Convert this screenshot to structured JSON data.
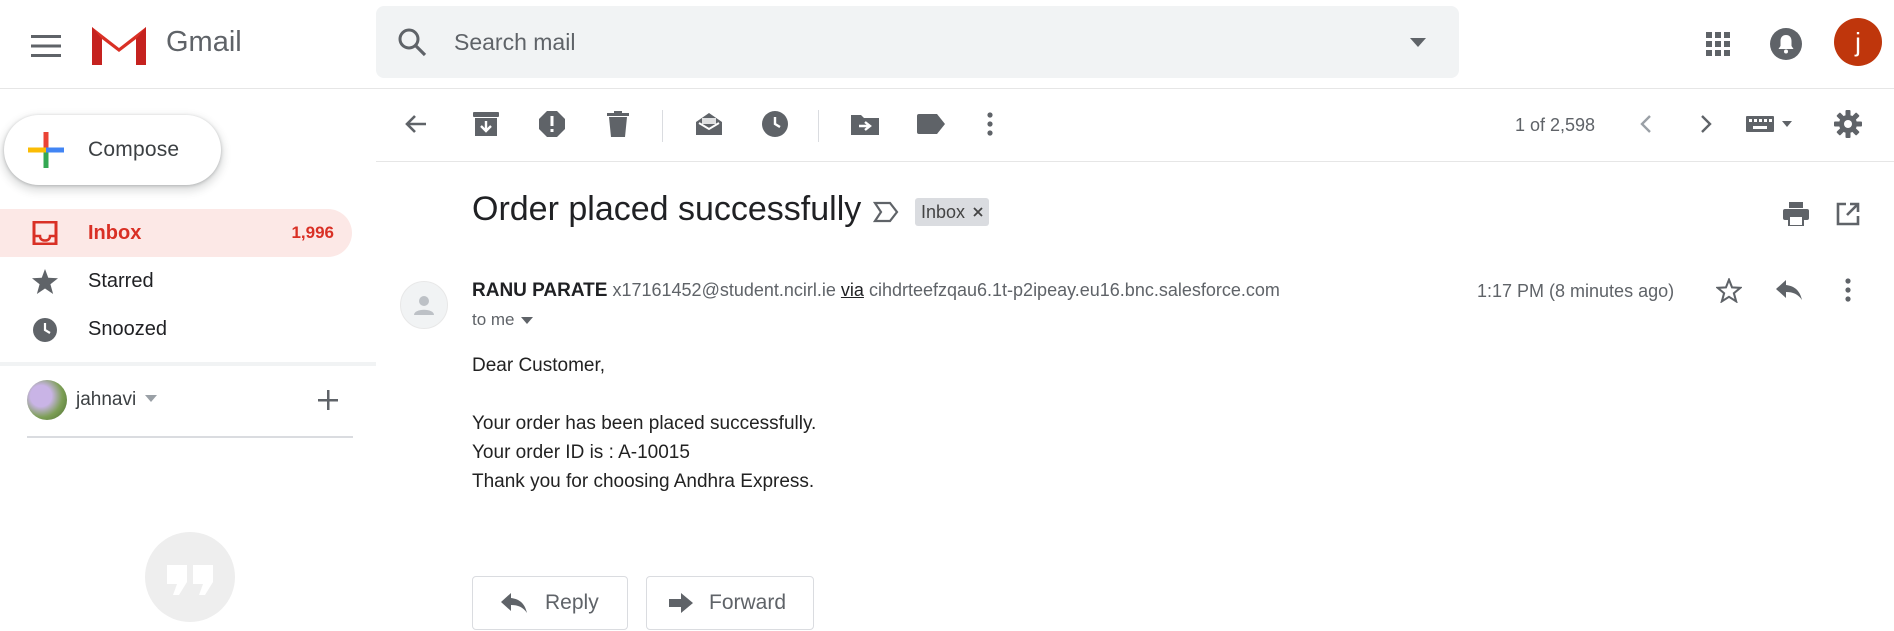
{
  "app": {
    "name": "Gmail",
    "avatar_letter": "j",
    "accent": "#d93025"
  },
  "search": {
    "placeholder": "Search mail",
    "value": ""
  },
  "sidebar": {
    "compose_label": "Compose",
    "items": [
      {
        "label": "Inbox",
        "count": "1,996",
        "icon": "inbox-icon",
        "active": true
      },
      {
        "label": "Starred",
        "icon": "star-icon"
      },
      {
        "label": "Snoozed",
        "icon": "clock-icon"
      }
    ],
    "hangouts_user": "jahnavi"
  },
  "toolbar": {
    "pager": "1 of 2,598",
    "icons": [
      "back-arrow-icon",
      "archive-icon",
      "report-spam-icon",
      "delete-icon",
      "mark-unread-icon",
      "snooze-icon",
      "move-to-icon",
      "label-icon",
      "more-vert-icon",
      "chevron-left-icon",
      "chevron-right-icon",
      "keyboard-icon",
      "settings-gear-icon"
    ]
  },
  "message": {
    "subject": "Order placed successfully",
    "label_chip": "Inbox",
    "sender_name": "RANU PARATE",
    "sender_email": "x17161452@student.ncirl.ie",
    "via_word": "via",
    "via_domain": "cihdrteefzqau6.1t-p2ipeay.eu16.bnc.salesforce.com",
    "time": "1:17 PM (8 minutes ago)",
    "recipient": "to me",
    "body": {
      "greeting": "Dear Customer,",
      "line1": "Your order has been placed successfully.",
      "line2": "Your order ID is : A-10015",
      "line3": "Thank you for choosing Andhra Express."
    }
  },
  "actions": {
    "reply": "Reply",
    "forward": "Forward"
  }
}
